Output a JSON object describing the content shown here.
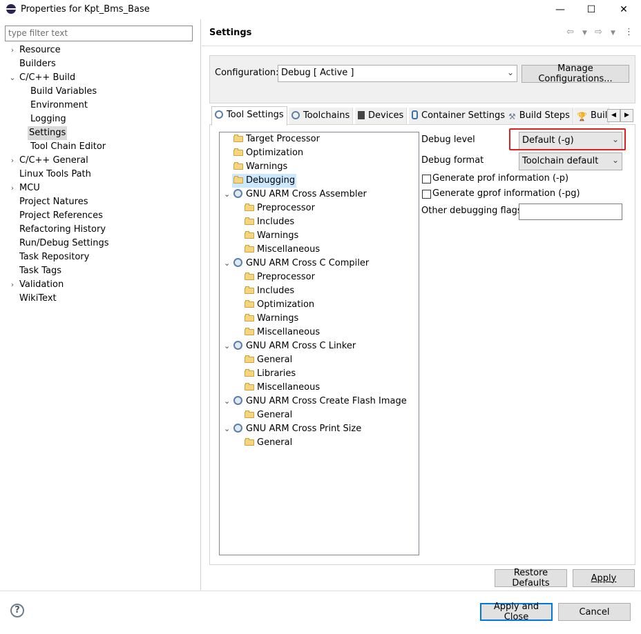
{
  "window": {
    "title": "Properties for Kpt_Bms_Base",
    "minimize": "—",
    "maximize": "☐",
    "close": "✕"
  },
  "filter": {
    "placeholder": "type filter text"
  },
  "nav": {
    "items": [
      {
        "label": "Resource"
      },
      {
        "label": "Builders"
      },
      {
        "label": "C/C++ Build"
      },
      {
        "label": "Build Variables"
      },
      {
        "label": "Environment"
      },
      {
        "label": "Logging"
      },
      {
        "label": "Settings"
      },
      {
        "label": "Tool Chain Editor"
      },
      {
        "label": "C/C++ General"
      },
      {
        "label": "Linux Tools Path"
      },
      {
        "label": "MCU"
      },
      {
        "label": "Project Natures"
      },
      {
        "label": "Project References"
      },
      {
        "label": "Refactoring History"
      },
      {
        "label": "Run/Debug Settings"
      },
      {
        "label": "Task Repository"
      },
      {
        "label": "Task Tags"
      },
      {
        "label": "Validation"
      },
      {
        "label": "WikiText"
      }
    ]
  },
  "page": {
    "title": "Settings"
  },
  "config": {
    "label": "Configuration:",
    "value": "Debug  [ Active ]",
    "manage_button": "Manage Configurations..."
  },
  "tabs": [
    {
      "label": "Tool Settings"
    },
    {
      "label": "Toolchains"
    },
    {
      "label": "Devices"
    },
    {
      "label": "Container Settings"
    },
    {
      "label": "Build Steps"
    },
    {
      "label": "Buil"
    }
  ],
  "tree": {
    "items": [
      {
        "label": "Target Processor"
      },
      {
        "label": "Optimization"
      },
      {
        "label": "Warnings"
      },
      {
        "label": "Debugging"
      },
      {
        "label": "GNU ARM Cross Assembler"
      },
      {
        "label": "Preprocessor"
      },
      {
        "label": "Includes"
      },
      {
        "label": "Warnings"
      },
      {
        "label": "Miscellaneous"
      },
      {
        "label": "GNU ARM Cross C Compiler"
      },
      {
        "label": "Preprocessor"
      },
      {
        "label": "Includes"
      },
      {
        "label": "Optimization"
      },
      {
        "label": "Warnings"
      },
      {
        "label": "Miscellaneous"
      },
      {
        "label": "GNU ARM Cross C Linker"
      },
      {
        "label": "General"
      },
      {
        "label": "Libraries"
      },
      {
        "label": "Miscellaneous"
      },
      {
        "label": "GNU ARM Cross Create Flash Image"
      },
      {
        "label": "General"
      },
      {
        "label": "GNU ARM Cross Print Size"
      },
      {
        "label": "General"
      }
    ]
  },
  "form": {
    "debug_level_label": "Debug level",
    "debug_level_value": "Default (-g)",
    "debug_format_label": "Debug format",
    "debug_format_value": "Toolchain default",
    "prof_label": "Generate prof information (-p)",
    "gprof_label": "Generate gprof information (-pg)",
    "other_flags_label": "Other debugging flags",
    "other_flags_value": ""
  },
  "buttons": {
    "restore_defaults": "Restore Defaults",
    "apply": "Apply",
    "apply_close": "Apply and Close",
    "cancel": "Cancel",
    "help": "?"
  },
  "colors": {
    "highlight": "#e02020",
    "selection": "#cce8ff"
  }
}
